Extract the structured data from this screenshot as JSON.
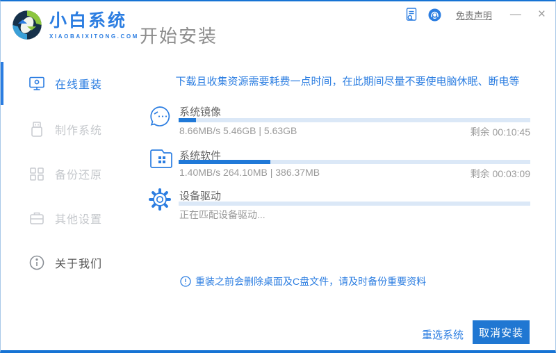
{
  "window": {
    "brand": {
      "name": "小白系统",
      "domain": "XIAOBAIXITONG.COM"
    },
    "page_title": "开始安装",
    "titlebar": {
      "icons": [
        "document-log-icon",
        "support-headset-icon"
      ],
      "disclaimer_label": "免责声明",
      "minimize_label": "—",
      "close_label": "×"
    }
  },
  "sidebar": {
    "items": [
      {
        "label": "在线重装",
        "icon": "monitor-icon",
        "active": true
      },
      {
        "label": "制作系统",
        "icon": "usb-drive-icon",
        "active": false
      },
      {
        "label": "备份还原",
        "icon": "blocks-icon",
        "active": false
      },
      {
        "label": "其他设置",
        "icon": "toolbox-icon",
        "active": false
      },
      {
        "label": "关于我们",
        "icon": "info-circle-icon",
        "active": false
      }
    ]
  },
  "main": {
    "notice": "下载且收集资源需要耗费一点时间，在此期间尽量不要使电脑休眠、断电等",
    "tasks": [
      {
        "title": "系统镜像",
        "icon": "face-chat-icon",
        "progress_percent": 5,
        "stats": "8.66MB/s 5.46GB | 5.63GB",
        "remaining": "剩余 00:10:45"
      },
      {
        "title": "系统软件",
        "icon": "folder-apps-icon",
        "progress_percent": 26,
        "stats": "1.40MB/s 264.10MB | 386.37MB",
        "remaining": "剩余 00:03:09"
      },
      {
        "title": "设备驱动",
        "icon": "gear-icon",
        "progress_percent": 0,
        "stats": "正在匹配设备驱动...",
        "remaining": ""
      }
    ],
    "warning": "重装之前会删除桌面及C盘文件，请及时备份重要资料"
  },
  "footer": {
    "reselect_label": "重选系统",
    "cancel_label": "取消安装"
  },
  "colors": {
    "accent": "#2b7de1",
    "progress_fill": "#2079d8",
    "progress_track": "#dbe8f7",
    "border_blue": "#1673d4",
    "inactive_gray": "#c5c8cc"
  }
}
